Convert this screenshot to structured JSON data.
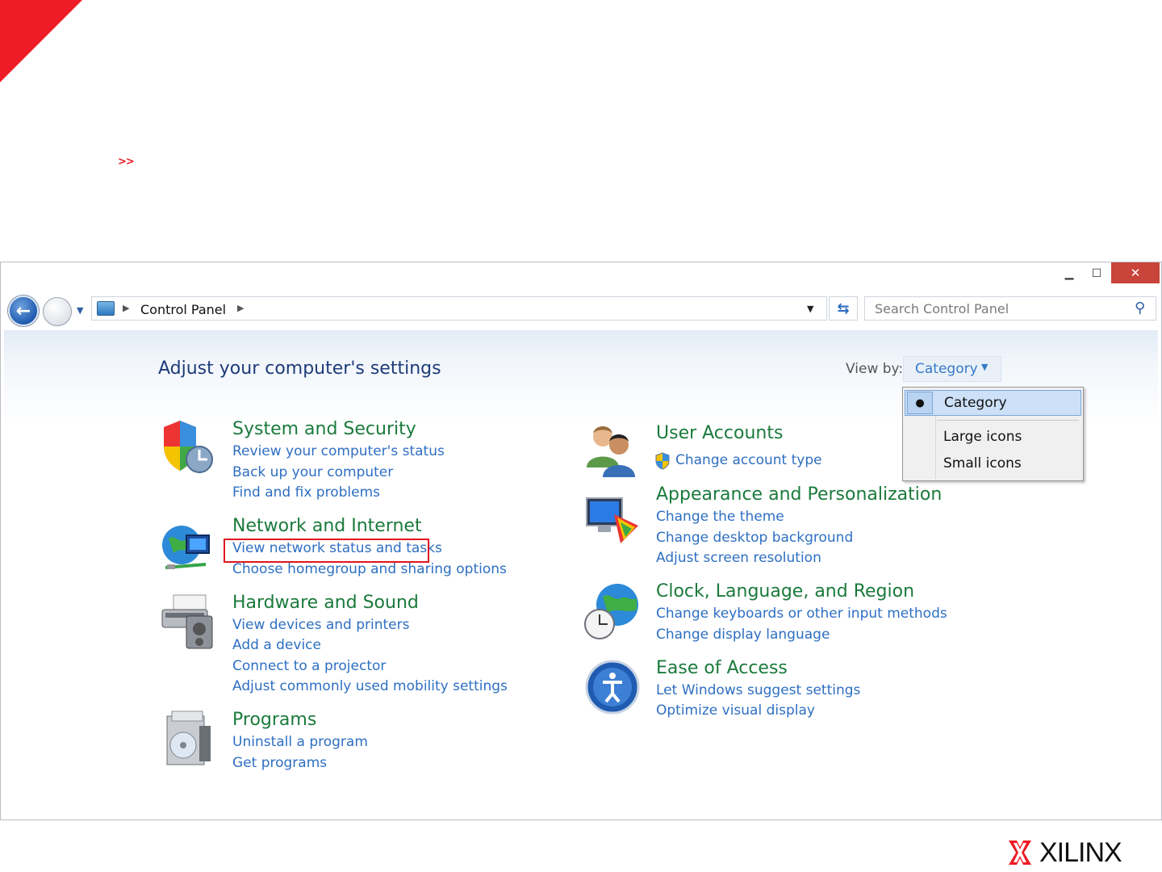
{
  "slide": {
    "bullet": ">>",
    "logo_text": "XILINX"
  },
  "window": {
    "min_icon": "minimize-icon",
    "max_icon": "maximize-icon",
    "close_icon": "close-icon"
  },
  "address_bar": {
    "path": "Control Panel",
    "search_placeholder": "Search Control Panel"
  },
  "content": {
    "title": "Adjust your computer's settings",
    "view_by_label": "View by:",
    "view_by_value": "Category",
    "view_options": [
      "Category",
      "Large icons",
      "Small icons"
    ]
  },
  "categories": [
    {
      "title": "System and Security",
      "icon": "shield-icon",
      "links": [
        "Review your computer's status",
        "Back up your computer",
        "Find and fix problems"
      ]
    },
    {
      "title": "Network and Internet",
      "icon": "network-globe-icon",
      "links": [
        "View network status and tasks",
        "Choose homegroup and sharing options"
      ]
    },
    {
      "title": "Hardware and Sound",
      "icon": "printer-speaker-icon",
      "links": [
        "View devices and printers",
        "Add a device",
        "Connect to a projector",
        "Adjust commonly used mobility settings"
      ]
    },
    {
      "title": "Programs",
      "icon": "programs-box-icon",
      "links": [
        "Uninstall a program",
        "Get programs"
      ]
    },
    {
      "title": "User Accounts",
      "icon": "users-icon",
      "links": [
        "Change account type"
      ]
    },
    {
      "title": "Appearance and Personalization",
      "icon": "monitor-palette-icon",
      "links": [
        "Change the theme",
        "Change desktop background",
        "Adjust screen resolution"
      ]
    },
    {
      "title": "Clock, Language, and Region",
      "icon": "globe-clock-icon",
      "links": [
        "Change keyboards or other input methods",
        "Change display language"
      ]
    },
    {
      "title": "Ease of Access",
      "icon": "ease-of-access-icon",
      "links": [
        "Let Windows suggest settings",
        "Optimize visual display"
      ]
    }
  ],
  "colors": {
    "accent_red": "#ee1c25",
    "category_green": "#1b7a3c",
    "link_blue": "#2e6fc2",
    "title_blue": "#1e3c78"
  }
}
